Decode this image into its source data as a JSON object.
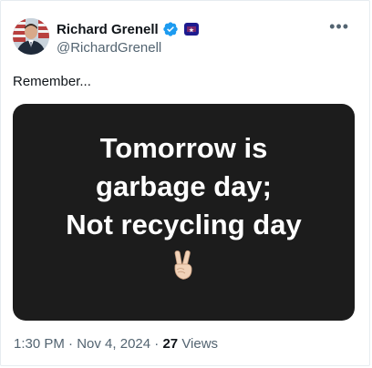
{
  "author": {
    "display_name": "Richard Grenell",
    "handle": "@RichardGrenell",
    "verified_icon": "verified-badge-icon",
    "affiliation_icon": "affiliation-badge-icon"
  },
  "post": {
    "text": "Remember...",
    "image_text": {
      "line1": "Tomorrow is",
      "line2": "garbage day;",
      "line3": "Not recycling day"
    },
    "image_emoji": "victory-hand-icon"
  },
  "meta": {
    "time": "1:30 PM",
    "separator1": " · ",
    "date": "Nov 4, 2024",
    "separator2": " · ",
    "views_count": "27",
    "views_label": "Views"
  },
  "colors": {
    "text_primary": "#0f1419",
    "text_secondary": "#536471",
    "verified_blue": "#1d9bf0",
    "media_bg": "#1c1c1c"
  }
}
